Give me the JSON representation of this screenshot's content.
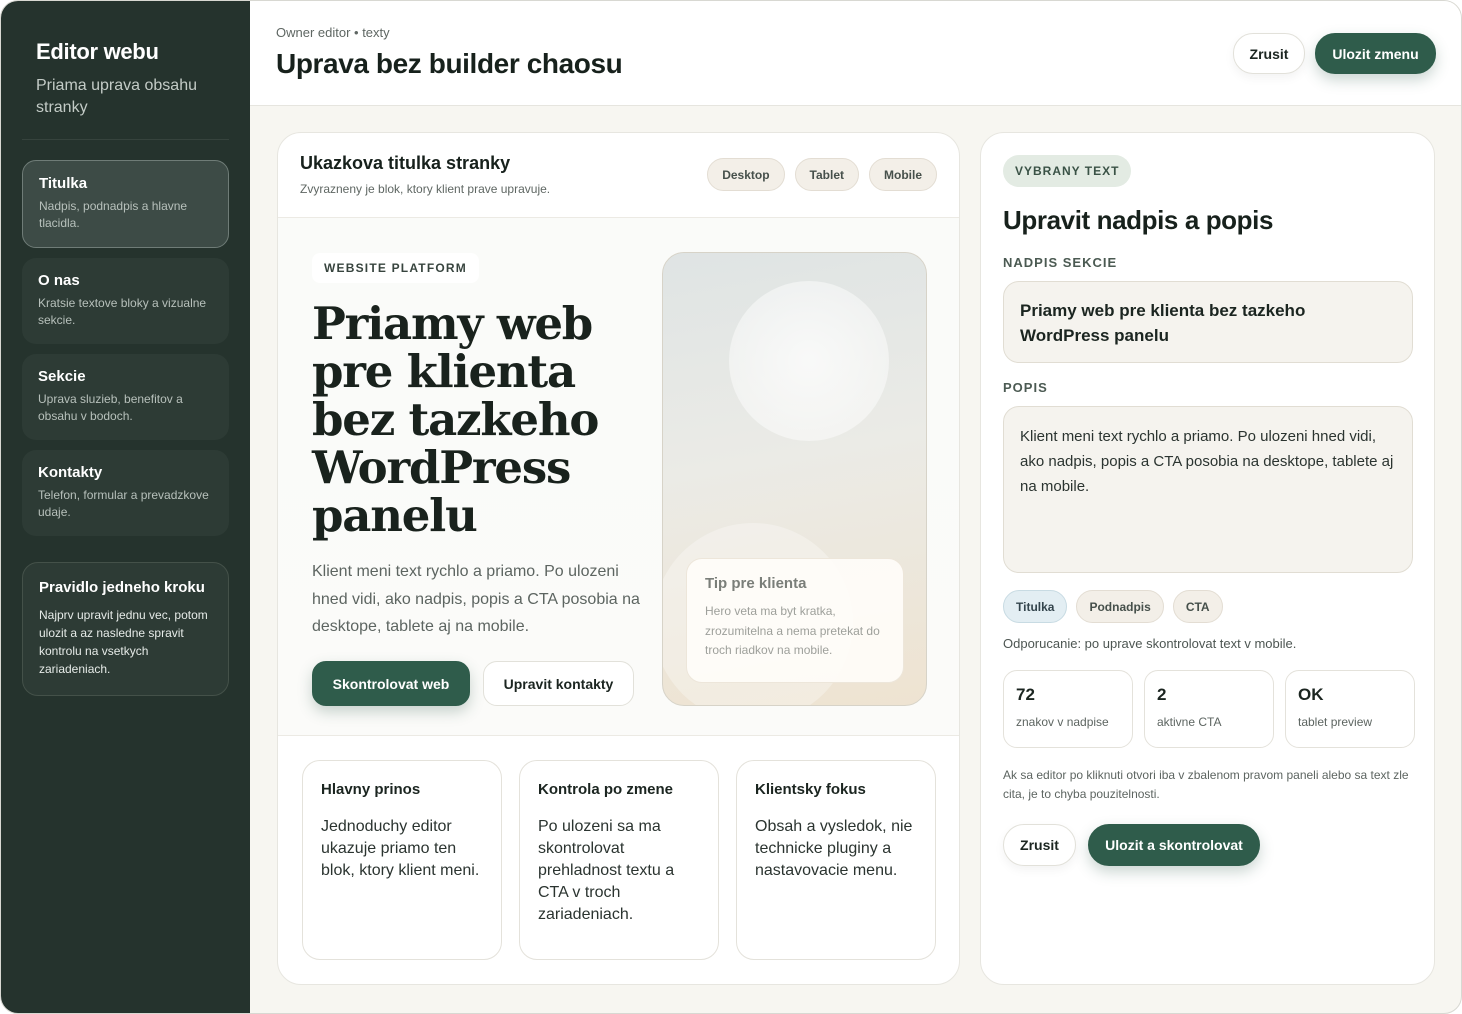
{
  "sidebar": {
    "title": "Editor webu",
    "subtitle": "Priama uprava obsahu stranky",
    "items": [
      {
        "label": "Titulka",
        "desc": "Nadpis, podnadpis a hlavne tlacidla."
      },
      {
        "label": "O nas",
        "desc": "Kratsie textove bloky a vizualne sekcie."
      },
      {
        "label": "Sekcie",
        "desc": "Uprava sluzieb, benefitov a obsahu v bodoch."
      },
      {
        "label": "Kontakty",
        "desc": "Telefon, formular a prevadzkove udaje."
      }
    ],
    "rule": {
      "title": "Pravidlo jedneho kroku",
      "text": "Najprv upravit jednu vec, potom ulozit a az nasledne spravit kontrolu na vsetkych zariadeniach."
    }
  },
  "header": {
    "breadcrumb": "Owner editor • texty",
    "title": "Uprava bez builder chaosu",
    "cancel_label": "Zrusit",
    "save_label": "Ulozit zmenu"
  },
  "preview": {
    "title": "Ukazkova titulka stranky",
    "desc": "Zvyrazneny je blok, ktory klient prave upravuje.",
    "devices": [
      "Desktop",
      "Tablet",
      "Mobile"
    ],
    "hero": {
      "eyebrow": "WEBSITE PLATFORM",
      "title": "Priamy web pre klienta bez tazkeho WordPress panelu",
      "desc": "Klient meni text rychlo a priamo. Po ulozeni hned vidi, ako nadpis, popis a CTA posobia na desktope, tablete aj na mobile.",
      "primary_btn": "Skontrolovat web",
      "secondary_btn": "Upravit kontakty",
      "tip_title": "Tip pre klienta",
      "tip_text": "Hero veta ma byt kratka, zrozumitelna a nema pretekat do troch riadkov na mobile."
    },
    "features": [
      {
        "title": "Hlavny prinos",
        "text": "Jednoduchy editor ukazuje priamo ten blok, ktory klient meni."
      },
      {
        "title": "Kontrola po zmene",
        "text": "Po ulozeni sa ma skontrolovat prehladnost textu a CTA v troch zariadeniach."
      },
      {
        "title": "Klientsky fokus",
        "text": "Obsah a vysledok, nie technicke pluginy a nastavovacie menu."
      }
    ]
  },
  "editor": {
    "badge": "VYBRANY TEXT",
    "title": "Upravit nadpis a popis",
    "heading_label": "NADPIS SEKCIE",
    "heading_value": "Priamy web pre klienta bez tazkeho WordPress panelu",
    "desc_label": "POPIS",
    "desc_value": "Klient meni text rychlo a priamo. Po ulozeni hned vidi, ako nadpis, popis a CTA posobia na desktope, tablete aj na mobile.",
    "chips": [
      "Titulka",
      "Podnadpis",
      "CTA"
    ],
    "recommendation": "Odporucanie: po uprave skontrolovat text v mobile.",
    "stats": [
      {
        "value": "72",
        "label": "znakov v nadpise"
      },
      {
        "value": "2",
        "label": "aktivne CTA"
      },
      {
        "value": "OK",
        "label": "tablet preview"
      }
    ],
    "note": "Ak sa editor po kliknuti otvori iba v zbalenom pravom paneli alebo sa text zle cita, je to chyba pouzitelnosti.",
    "cancel_label": "Zrusit",
    "save_label": "Ulozit a skontrolovat"
  },
  "colors": {
    "sidebar_bg": "#25332d",
    "accent": "#2f5c4b",
    "panel_bg": "#ffffff",
    "page_bg": "#f7f6f1"
  }
}
